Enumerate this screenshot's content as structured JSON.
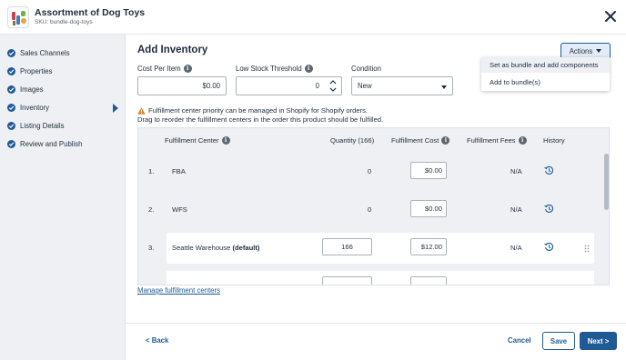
{
  "header": {
    "title": "Assortment of Dog Toys",
    "sku": "SKU: bundle-dog-toys"
  },
  "sidebar": {
    "items": [
      {
        "label": "Sales Channels",
        "completed": true
      },
      {
        "label": "Properties",
        "completed": true
      },
      {
        "label": "Images",
        "completed": true
      },
      {
        "label": "Inventory",
        "completed": true,
        "active": true
      },
      {
        "label": "Listing Details",
        "completed": true
      },
      {
        "label": "Review and Publish",
        "completed": true
      }
    ]
  },
  "main": {
    "title": "Add Inventory",
    "actions_label": "Actions",
    "actions_menu": [
      "Set as bundle and add components",
      "Add to bundle(s)"
    ],
    "fields": {
      "cost_per_item": {
        "label": "Cost Per Item",
        "value": "$0.00"
      },
      "low_stock_threshold": {
        "label": "Low Stock Threshold",
        "value": "0"
      },
      "condition": {
        "label": "Condition",
        "value": "New"
      }
    },
    "warning_line1": "Fulfillment center priority can be managed in Shopify for Shopify orders.",
    "warning_line2": "Drag to reorder the fulfillment centers in the order this product should be fulfilled.",
    "table": {
      "headers": {
        "fulfillment_center": "Fulfillment Center",
        "quantity": "Quantity (166)",
        "fulfillment_cost": "Fulfillment Cost",
        "fulfillment_fees": "Fulfillment Fees",
        "history": "History"
      },
      "rows": [
        {
          "num": "1.",
          "name": "FBA",
          "suffix": "",
          "quantity": "0",
          "cost": "$0.00",
          "fees": "N/A"
        },
        {
          "num": "2.",
          "name": "WFS",
          "suffix": "",
          "quantity": "0",
          "cost": "$0.00",
          "fees": "N/A"
        },
        {
          "num": "3.",
          "name": "Seattle Warehouse",
          "suffix": "(default)",
          "quantity": "166",
          "cost": "$12.00",
          "fees": "N/A"
        }
      ]
    },
    "manage_link": "Manage fulfillment centers"
  },
  "footer": {
    "back_label": "< Back",
    "cancel_label": "Cancel",
    "save_label": "Save",
    "next_label": "Next >"
  },
  "colors": {
    "primary": "#1f5a96",
    "sidebar_bg": "#eef0f3",
    "warning": "#d9822b"
  }
}
